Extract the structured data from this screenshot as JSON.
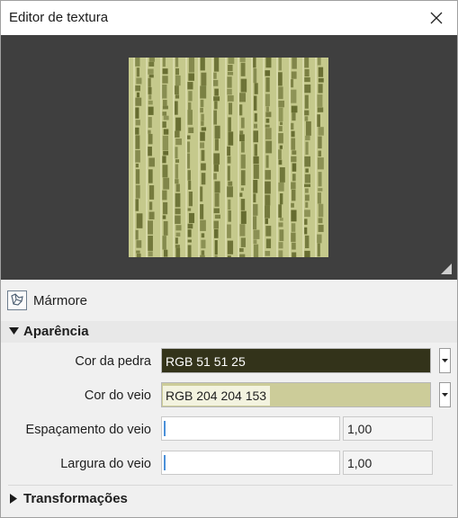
{
  "window": {
    "title": "Editor de textura"
  },
  "material": {
    "name": "Mármore",
    "icon": "marble-material-icon"
  },
  "sections": {
    "appearance": {
      "label": "Aparência",
      "expanded": true,
      "properties": {
        "stone_color": {
          "label": "Cor da pedra",
          "value": "RGB 51 51 25",
          "color": "#33331a"
        },
        "vein_color": {
          "label": "Cor do veio",
          "value": "RGB 204 204 153",
          "color": "#cccc99"
        },
        "vein_spacing": {
          "label": "Espaçamento do veio",
          "value": "1,00",
          "level": 0.0
        },
        "vein_width": {
          "label": "Largura do veio",
          "value": "1,00",
          "level": 0.0
        }
      }
    },
    "transforms": {
      "label": "Transformações",
      "expanded": false
    }
  },
  "colors": {
    "preview_background": "#3f3f3f",
    "texture_base": "#c5c98c",
    "texture_stripe": "#646a2e",
    "accent": "#4a90d9"
  }
}
